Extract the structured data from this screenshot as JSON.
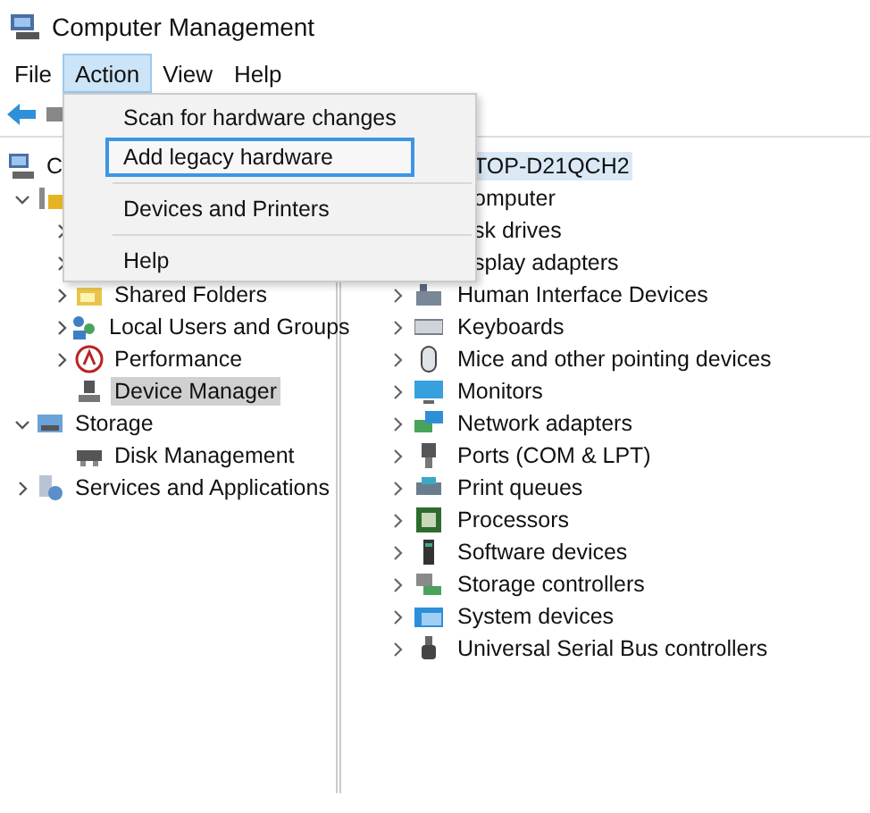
{
  "window": {
    "title": "Computer Management"
  },
  "menu_bar": [
    {
      "label": "File",
      "selected": false
    },
    {
      "label": "Action",
      "selected": true
    },
    {
      "label": "View",
      "selected": false
    },
    {
      "label": "Help",
      "selected": false
    }
  ],
  "action_menu": [
    {
      "kind": "item",
      "label": "Scan for hardware changes",
      "highlighted": false
    },
    {
      "kind": "item",
      "label": "Add legacy hardware",
      "highlighted": true
    },
    {
      "kind": "separator"
    },
    {
      "kind": "item",
      "label": "Devices and Printers",
      "highlighted": false
    },
    {
      "kind": "separator"
    },
    {
      "kind": "item",
      "label": "Help",
      "highlighted": false
    }
  ],
  "navigation_tree": [
    {
      "label": "C",
      "selected": false,
      "children": [
        {
          "expanded": true,
          "children": [
            {
              "expanded": false
            },
            {
              "expanded": false
            },
            {
              "label": "Shared Folders",
              "expanded": false,
              "selected": false
            },
            {
              "label": "Local Users and Groups",
              "expanded": false,
              "selected": false
            },
            {
              "label": "Performance",
              "expanded": false,
              "selected": false
            },
            {
              "label": "Device Manager",
              "selected": true
            }
          ]
        },
        {
          "label": "Storage",
          "expanded": true,
          "selected": false,
          "children": [
            {
              "label": "Disk Management",
              "selected": false
            }
          ]
        },
        {
          "label": "Services and Applications",
          "expanded": false,
          "selected": false
        }
      ]
    }
  ],
  "device_tree": {
    "label": "TOP-D21QCH2",
    "selected": true,
    "children": [
      {
        "kind": "partly_hidden",
        "label": "omputer"
      },
      {
        "kind": "partly_hidden",
        "label": "sk drives"
      },
      {
        "kind": "partly_hidden",
        "label": "splay adapters"
      },
      {
        "kind": "device",
        "label": "Human Interface Devices",
        "expanded": false
      },
      {
        "kind": "device",
        "label": "Keyboards",
        "expanded": false
      },
      {
        "kind": "device",
        "label": "Mice and other pointing devices",
        "expanded": false
      },
      {
        "kind": "device",
        "label": "Monitors",
        "expanded": false
      },
      {
        "kind": "device",
        "label": "Network adapters",
        "expanded": false
      },
      {
        "kind": "device",
        "label": "Ports (COM & LPT)",
        "expanded": false
      },
      {
        "kind": "device",
        "label": "Print queues",
        "expanded": false
      },
      {
        "kind": "device",
        "label": "Processors",
        "expanded": false
      },
      {
        "kind": "device",
        "label": "Software devices",
        "expanded": false
      },
      {
        "kind": "device",
        "label": "Storage controllers",
        "expanded": false
      },
      {
        "kind": "device",
        "label": "System devices",
        "expanded": false
      },
      {
        "kind": "device",
        "label": "Universal Serial Bus controllers",
        "expanded": false
      }
    ]
  }
}
